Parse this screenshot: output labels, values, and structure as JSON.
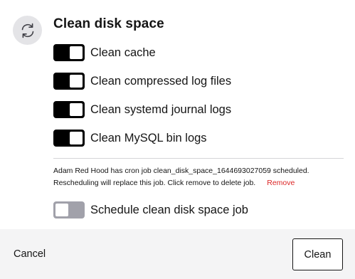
{
  "dialog": {
    "title": "Clean disk space",
    "icon": "refresh-icon"
  },
  "options": [
    {
      "label": "Clean cache",
      "enabled": true
    },
    {
      "label": "Clean compressed log files",
      "enabled": true
    },
    {
      "label": "Clean systemd journal logs",
      "enabled": true
    },
    {
      "label": "Clean MySQL bin logs",
      "enabled": true
    }
  ],
  "cron_note": {
    "line1": "Adam Red Hood has cron job clean_disk_space_1644693027059 scheduled.",
    "line2": "Rescheduling will replace this job. Click remove to delete job.",
    "remove_label": "Remove"
  },
  "schedule": {
    "label": "Schedule clean disk space job",
    "enabled": false
  },
  "footer": {
    "cancel_label": "Cancel",
    "clean_label": "Clean"
  },
  "colors": {
    "accent": "#000000",
    "danger": "#dc2626",
    "footer_bg": "#f4f4f5",
    "icon_bg": "#e4e4e7"
  }
}
